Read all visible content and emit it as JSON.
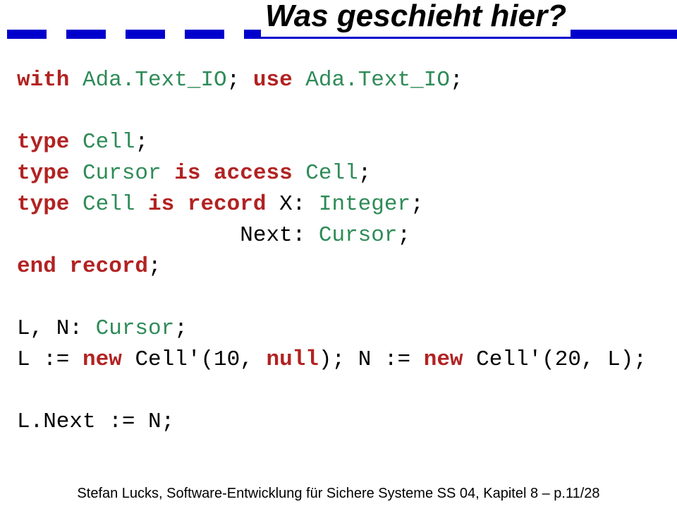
{
  "title": "Was geschieht hier?",
  "code": {
    "l1a": "with ",
    "l1b": "Ada.Text_IO",
    "l1c": "; ",
    "l1d": "use ",
    "l1e": "Ada.Text_IO",
    "l1f": ";",
    "l2a": "type ",
    "l2b": "Cell",
    "l2c": ";",
    "l3a": "type ",
    "l3b": "Cursor ",
    "l3c": "is access ",
    "l3d": "Cell",
    "l3e": ";",
    "l4a": "type ",
    "l4b": "Cell ",
    "l4c": "is record ",
    "l4d": "X: ",
    "l4e": "Integer",
    "l4f": ";",
    "l5a": "                 Next: ",
    "l5b": "Cursor",
    "l5c": ";",
    "l6a": "end record",
    "l6b": ";",
    "l7a": "L, N: ",
    "l7b": "Cursor",
    "l7c": ";",
    "l8a": "L := ",
    "l8b": "new ",
    "l8c": "Cell'(10, ",
    "l8d": "null",
    "l8e": "); N := ",
    "l8f": "new ",
    "l8g": "Cell'(20, L);",
    "l9a": "L.Next := N;"
  },
  "footer": "Stefan Lucks, Software-Entwicklung für Sichere Systeme SS 04, Kapitel 8 – p.11/28"
}
